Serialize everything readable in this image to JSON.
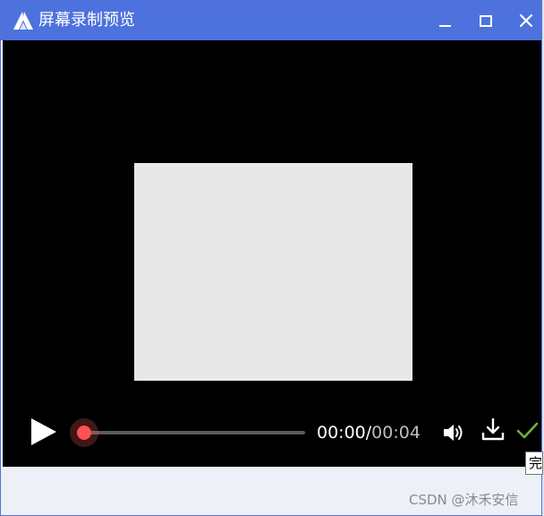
{
  "window": {
    "title": "屏幕录制预览",
    "icon": "app-logo-icon",
    "controls": [
      "minimize-icon",
      "maximize-icon",
      "close-icon"
    ]
  },
  "player": {
    "current_time": "00:00",
    "separator": "/",
    "duration": "00:04",
    "progress": 0.0,
    "preview_color": "#e8e8e8",
    "accent_color": "#ff5151"
  },
  "tooltip": {
    "text": "完"
  },
  "watermark": {
    "text": "CSDN @沐禾安信"
  },
  "colors": {
    "titlebar": "#4d72dd",
    "video_background": "#000000",
    "footer": "#eef0f7"
  }
}
